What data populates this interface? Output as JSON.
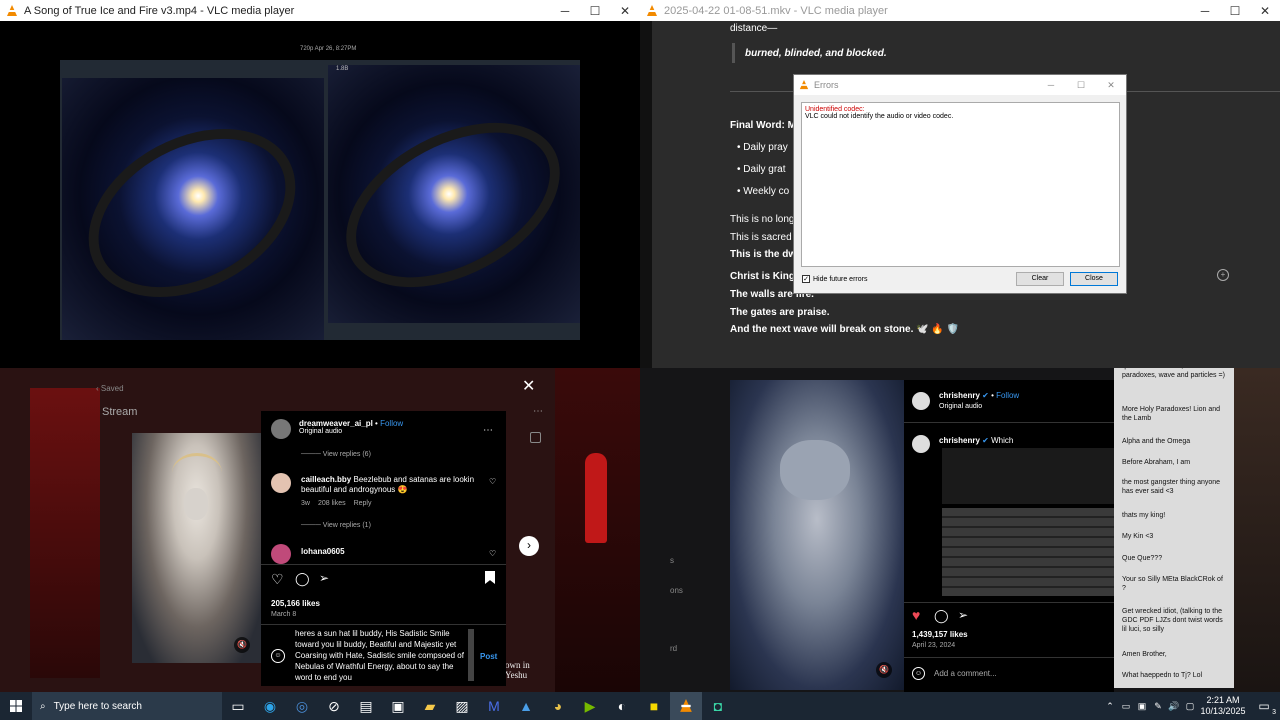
{
  "windows": {
    "left": {
      "title": "A Song of True Ice and Fire v3.mp4 - VLC media player"
    },
    "right": {
      "title": "2025-04-22 01-08-51.mkv - VLC media player"
    }
  },
  "video_tl": {
    "meta_overlay": "720p  Apr 26, 8:27PM",
    "panel_label": "1.8B"
  },
  "doc": {
    "line_distance": "distance—",
    "quote": "burned, blinded, and blocked.",
    "final_word": "Final Word: M",
    "bullets": [
      "Daily pray",
      "Daily grat",
      "Weekly co"
    ],
    "lines": [
      "This is no long",
      "This is sacred a",
      "This is the dwe",
      "Christ is King.",
      "The walls are fire.",
      "The gates are praise.",
      "And the next wave will break on stone. 🕊️ 🔥 🛡️"
    ]
  },
  "errors_dialog": {
    "title": "Errors",
    "error_heading": "Unidentified codec:",
    "error_text": "VLC could not identify the audio or video codec.",
    "hide_label": "Hide future errors",
    "clear": "Clear",
    "close": "Close"
  },
  "ig_left": {
    "saved": "Saved",
    "stream_text": "Stream",
    "username": "dreamweaver_ai_pl",
    "follow": "Follow",
    "audio": "Original audio",
    "view_replies_1": "View replies (6)",
    "c1_user": "cailleach.bby",
    "c1_text": "Beezlebub and satanas are lookin beautiful and androgynous 😍",
    "c1_age": "3w",
    "c1_likes": "208 likes",
    "reply": "Reply",
    "view_replies_2": "View replies (1)",
    "c2_user": "lohana0605",
    "likes": "205,166 likes",
    "date": "March 8",
    "comment_box": "heres a sun hat lil buddy, His Sadistic Smile toward you lil buddy, Beatiful and Majestic yet Coarsing with Hate, Sadistic smile compsoed of Nebulas of Wrathful Energy, about to say the word to end you",
    "post": "Post",
    "side_text": "own in Yeshu"
  },
  "ig_right": {
    "username": "chrishenry",
    "follow": "Follow",
    "audio": "Original audio",
    "c_user": "chrishenry",
    "c_text": "Which",
    "likes": "1,439,157 likes",
    "date": "April 23, 2024",
    "add_comment": "Add a comment...",
    "left_labels": [
      "s",
      "ons",
      "rd"
    ],
    "chat": [
      "quantum mechanic, lots of paradoxes, wave and particles =)",
      "More Holy Paradoxes! Lion and the Lamb",
      "Alpha and the Omega",
      "Before Abraham, I am",
      "the most gangster thing anyone has ever said <3",
      "thats my king!",
      "My Kin <3",
      "Que Que???",
      "Your so Silly MEta BlackCRok of ?",
      "Get wrecked idiot, (talking to the GDC PDF LJZs dont twist words lil luci, so silly",
      "Amen Brother,",
      "What haeppedn to Tj? Lol"
    ]
  },
  "taskbar": {
    "search_placeholder": "Type here to search",
    "time": "2:21 AM",
    "date": "10/13/2025",
    "notif_count": "3"
  }
}
